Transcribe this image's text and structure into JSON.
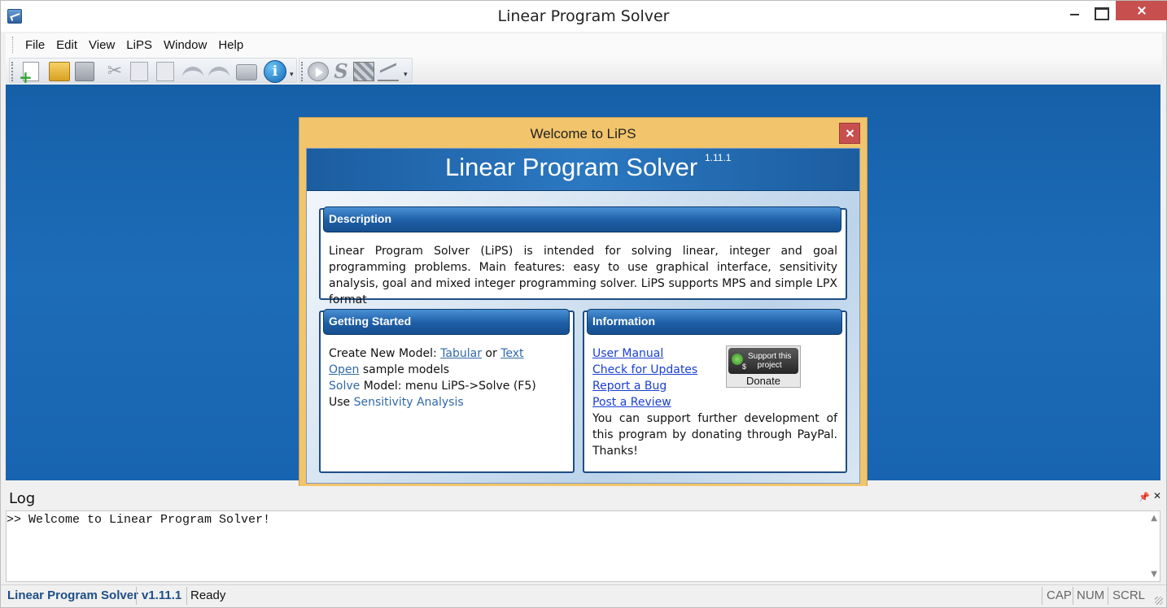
{
  "window": {
    "title": "Linear Program Solver"
  },
  "menu": {
    "items": [
      "File",
      "Edit",
      "View",
      "LiPS",
      "Window",
      "Help"
    ]
  },
  "toolbar": {
    "icons": [
      "new-model-icon",
      "open-icon",
      "save-icon",
      "cut-icon",
      "copy-icon",
      "paste-icon",
      "undo-icon",
      "redo-icon",
      "print-icon",
      "info-icon",
      "run-icon",
      "solve-icon",
      "zoom-icon",
      "graph-icon"
    ]
  },
  "dialog": {
    "title": "Welcome to LiPS",
    "banner_title": "Linear Program Solver",
    "banner_version": "1.11.1",
    "description": {
      "heading": "Description",
      "text": "Linear Program Solver (LiPS) is intended for solving linear, integer and goal programming problems. Main features: easy to use graphical interface, sensitivity analysis, goal and mixed integer programming solver. LiPS supports MPS and simple LPX format"
    },
    "getting_started": {
      "heading": "Getting Started",
      "line1_prefix": "Create New Model: ",
      "link_tabular": "Tabular",
      "line1_or": " or ",
      "link_text": "Text",
      "link_open": "Open",
      "line2_suffix": " sample models",
      "link_solve": "Solve",
      "line3_suffix": " Model: menu LiPS->Solve (F5)",
      "line4_prefix": "Use ",
      "link_sensitivity": "Sensitivity Analysis"
    },
    "information": {
      "heading": "Information",
      "links": [
        "User Manual",
        "Check for Updates",
        "Report a Bug",
        "Post a Review"
      ],
      "support_text": "You can support further development of this program by donating through PayPal. Thanks!",
      "donate_badge_line1": "Support this",
      "donate_badge_line2": "project",
      "donate_badge_symbol": "$",
      "donate_label": "Donate"
    }
  },
  "log": {
    "title": "Log",
    "lines": [
      ">> Welcome to Linear Program Solver!"
    ]
  },
  "statusbar": {
    "app_name": "Linear Program Solver",
    "version": "v1.11.1",
    "status": "Ready",
    "keys": [
      "CAP",
      "NUM",
      "SCRL"
    ]
  }
}
